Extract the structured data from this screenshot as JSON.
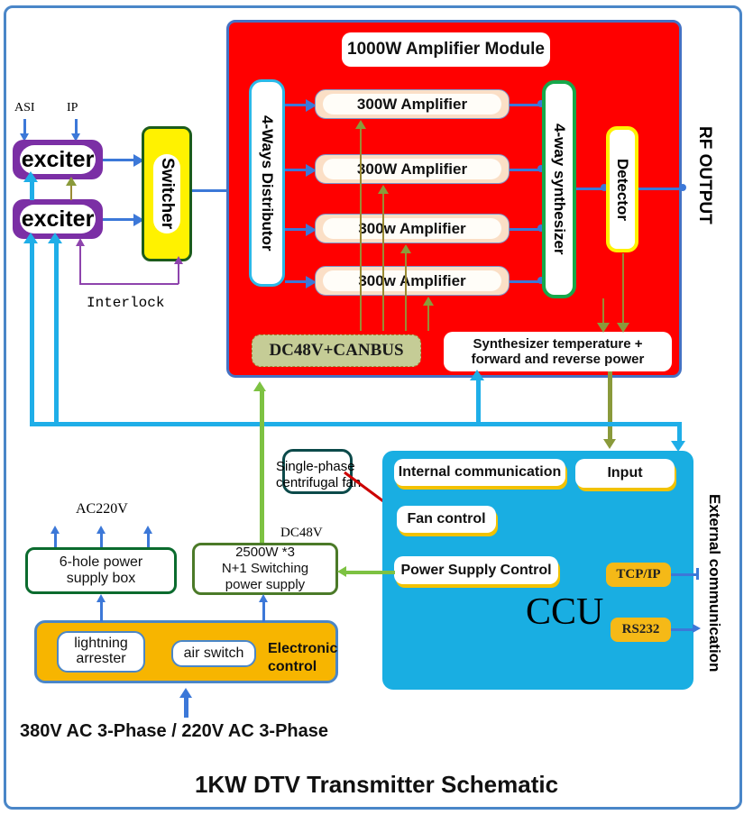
{
  "diagram": {
    "title": "1KW DTV Transmitter Schematic",
    "colors": {
      "frame_border": "#4a86c8",
      "amplifier_panel": "#FF0000",
      "ccu_panel": "#19AEE2",
      "exciter": "#7B2FA5",
      "switcher": "#FFF200",
      "electronic_control": "#F7B500",
      "canbus": "#C5CC96",
      "gold_port": "#F5B917",
      "blue_signal": "#3C78D8",
      "cyan_bus": "#1FAEE8",
      "green_power": "#7DC242",
      "olive_control": "#8A9A3B",
      "red_fan_link": "#CC0000"
    },
    "inputs": {
      "asi_label": "ASI",
      "ip_label": "IP"
    },
    "exciters": [
      {
        "label": "exciter"
      },
      {
        "label": "exciter"
      }
    ],
    "switcher": {
      "label": "Switcher"
    },
    "interlock_label": "Interlock",
    "amplifier_module": {
      "title": "1000W Amplifier Module",
      "distributor": "4-Ways Distributor",
      "amplifiers": [
        {
          "label": "300W Amplifier"
        },
        {
          "label": "300W Amplifier"
        },
        {
          "label": "300w Amplifier"
        },
        {
          "label": "300w Amplifier"
        }
      ],
      "synthesizer": "4-way synthesizer",
      "detector": "Detector",
      "power_bus": "DC48V+CANBUS",
      "telemetry": "Synthesizer temperature +\nforward and reverse power"
    },
    "rf_output_label": "RF OUTPUT",
    "external_comm_label": "External communication",
    "ccu": {
      "name": "CCU",
      "blocks": [
        {
          "label": "Internal communication"
        },
        {
          "label": "Input"
        },
        {
          "label": "Fan control"
        },
        {
          "label": "Power Supply Control"
        }
      ],
      "ports": [
        {
          "label": "TCP/IP"
        },
        {
          "label": "RS232"
        }
      ]
    },
    "fan": {
      "label": "Single-phase\ncentrifugal fan"
    },
    "power": {
      "ac220v_label": "AC220V",
      "dc48v_label": "DC48V",
      "six_hole_box": "6-hole power\nsupply box",
      "switching_supply": "2500W *3\nN+1 Switching\npower supply",
      "electronic_control_label": "Electronic\ncontrol",
      "lightning_arrester": "lightning\narrester",
      "air_switch": "air switch",
      "mains_label": "380V AC 3-Phase / 220V AC 3-Phase"
    }
  }
}
